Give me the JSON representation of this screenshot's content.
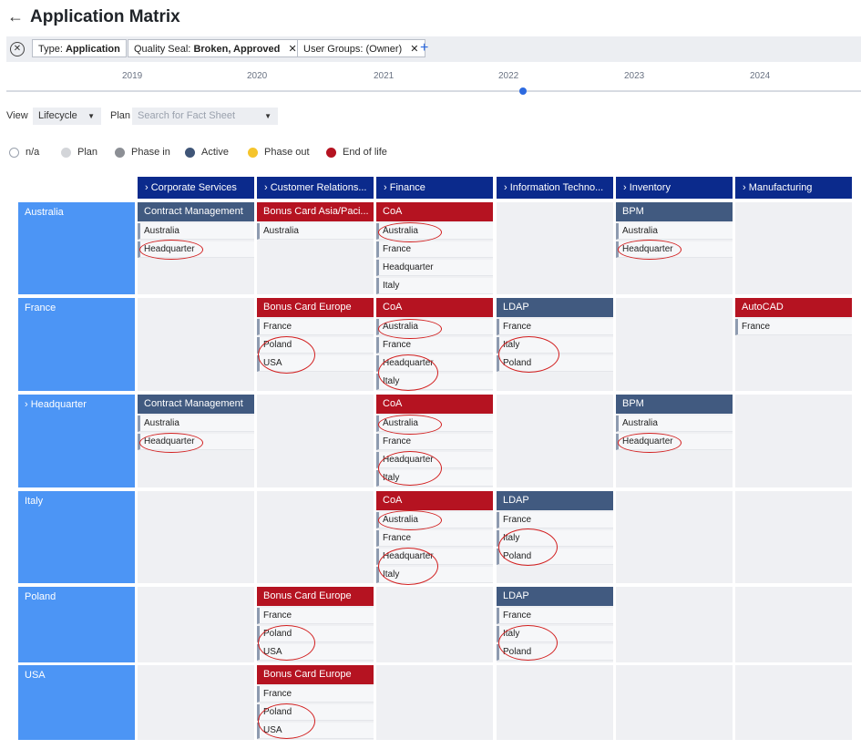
{
  "header": {
    "back_icon": "arrow-left-icon",
    "title": "Application Matrix"
  },
  "filters": {
    "chips": [
      {
        "key": "Type:",
        "value": "Application"
      },
      {
        "key": "Quality Seal:",
        "value": "Broken, Approved",
        "remove": "✕"
      },
      {
        "key": "User Groups:",
        "value": "(Owner)",
        "remove": "✕"
      }
    ],
    "clear_icon": "✕",
    "add_label": "+"
  },
  "timeline": {
    "years": [
      "2019",
      "2020",
      "2021",
      "2022",
      "2023",
      "2024"
    ],
    "current_year": "2022"
  },
  "view": {
    "label": "View",
    "value": "Lifecycle",
    "plan_label": "Plan",
    "plan_placeholder": "Search for Fact Sheet"
  },
  "legend": [
    {
      "label": "n/a",
      "color": "#ffffff"
    },
    {
      "label": "Plan",
      "color": "#d3d5d9"
    },
    {
      "label": "Phase in",
      "color": "#8c8f95"
    },
    {
      "label": "Active",
      "color": "#3f5577"
    },
    {
      "label": "Phase out",
      "color": "#f5c42c"
    },
    {
      "label": "End of life",
      "color": "#b51321"
    }
  ],
  "columns": [
    {
      "label": "Corporate Services"
    },
    {
      "label": "Customer Relations..."
    },
    {
      "label": "Finance"
    },
    {
      "label": "Information Techno..."
    },
    {
      "label": "Inventory"
    },
    {
      "label": "Manufacturing"
    }
  ],
  "rows": [
    {
      "label": "Australia",
      "expandable": false,
      "cells": [
        {
          "app": "Contract Management",
          "status": "active",
          "subs": [
            "Australia",
            "Headquarter"
          ]
        },
        {
          "app": "Bonus Card Asia/Paci...",
          "status": "end-of-life",
          "subs": [
            "Australia"
          ]
        },
        {
          "app": "CoA",
          "status": "end-of-life",
          "subs": [
            "Australia",
            "France",
            "Headquarter",
            "Italy"
          ]
        },
        null,
        {
          "app": "BPM",
          "status": "active",
          "subs": [
            "Australia",
            "Headquarter"
          ]
        },
        null
      ]
    },
    {
      "label": "France",
      "expandable": false,
      "cells": [
        null,
        {
          "app": "Bonus Card Europe",
          "status": "end-of-life",
          "subs": [
            "France",
            "Poland",
            "USA"
          ]
        },
        {
          "app": "CoA",
          "status": "end-of-life",
          "subs": [
            "Australia",
            "France",
            "Headquarter",
            "Italy"
          ]
        },
        {
          "app": "LDAP",
          "status": "active",
          "subs": [
            "France",
            "Italy",
            "Poland"
          ]
        },
        null,
        {
          "app": "AutoCAD",
          "status": "end-of-life",
          "subs": [
            "France"
          ]
        }
      ]
    },
    {
      "label": "Headquarter",
      "expandable": true,
      "cells": [
        {
          "app": "Contract Management",
          "status": "active",
          "subs": [
            "Australia",
            "Headquarter"
          ]
        },
        null,
        {
          "app": "CoA",
          "status": "end-of-life",
          "subs": [
            "Australia",
            "France",
            "Headquarter",
            "Italy"
          ]
        },
        null,
        {
          "app": "BPM",
          "status": "active",
          "subs": [
            "Australia",
            "Headquarter"
          ]
        },
        null
      ]
    },
    {
      "label": "Italy",
      "expandable": false,
      "cells": [
        null,
        null,
        {
          "app": "CoA",
          "status": "end-of-life",
          "subs": [
            "Australia",
            "France",
            "Headquarter",
            "Italy"
          ]
        },
        {
          "app": "LDAP",
          "status": "active",
          "subs": [
            "France",
            "Italy",
            "Poland"
          ]
        },
        null,
        null
      ]
    },
    {
      "label": "Poland",
      "expandable": false,
      "cells": [
        null,
        {
          "app": "Bonus Card Europe",
          "status": "end-of-life",
          "subs": [
            "France",
            "Poland",
            "USA"
          ]
        },
        null,
        {
          "app": "LDAP",
          "status": "active",
          "subs": [
            "France",
            "Italy",
            "Poland"
          ]
        },
        null,
        null
      ]
    },
    {
      "label": "USA",
      "expandable": false,
      "cells": [
        null,
        {
          "app": "Bonus Card Europe",
          "status": "end-of-life",
          "subs": [
            "France",
            "Poland",
            "USA"
          ]
        },
        null,
        null,
        null,
        null
      ]
    }
  ]
}
